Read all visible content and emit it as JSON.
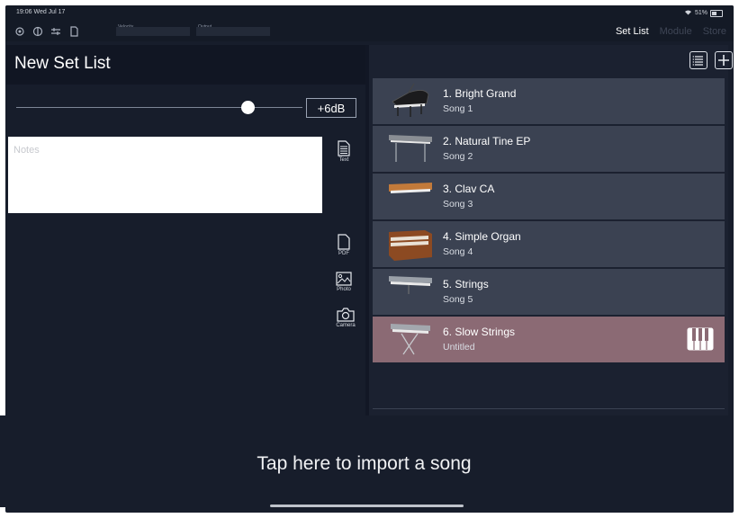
{
  "status": {
    "time": "19:06  Wed Jul 17",
    "battery": "51%"
  },
  "meters": {
    "velocity_label": "Velocity",
    "output_label": "Output"
  },
  "top_tabs": [
    {
      "label": "Set List",
      "active": true
    },
    {
      "label": "Module",
      "active": false
    },
    {
      "label": "Store",
      "active": false
    }
  ],
  "left": {
    "title": "New Set List",
    "gain_button": "+6dB",
    "slider_level": 0.83,
    "notes_placeholder": "Notes",
    "side_buttons": {
      "text": "Text",
      "pdf": "PDF",
      "photo": "Photo",
      "camera": "Camera"
    }
  },
  "songs": [
    {
      "title": "1. Bright Grand",
      "sub": "Song 1",
      "icon": "grand-piano",
      "selected": false
    },
    {
      "title": "2. Natural Tine EP",
      "sub": "Song 2",
      "icon": "electric-piano",
      "selected": false
    },
    {
      "title": "3. Clav CA",
      "sub": "Song 3",
      "icon": "clavinet",
      "selected": false
    },
    {
      "title": "4. Simple Organ",
      "sub": "Song 4",
      "icon": "organ",
      "selected": false
    },
    {
      "title": "5. Strings",
      "sub": "Song 5",
      "icon": "synth-keyboard",
      "selected": false
    },
    {
      "title": "6. Slow Strings",
      "sub": "Untitled",
      "icon": "synth-keyboard-stand",
      "selected": true
    }
  ],
  "import_text": "Tap here to import a song",
  "colors": {
    "background": "#171d2b",
    "row": "#3b4252",
    "row_selected": "#8b6a74"
  }
}
